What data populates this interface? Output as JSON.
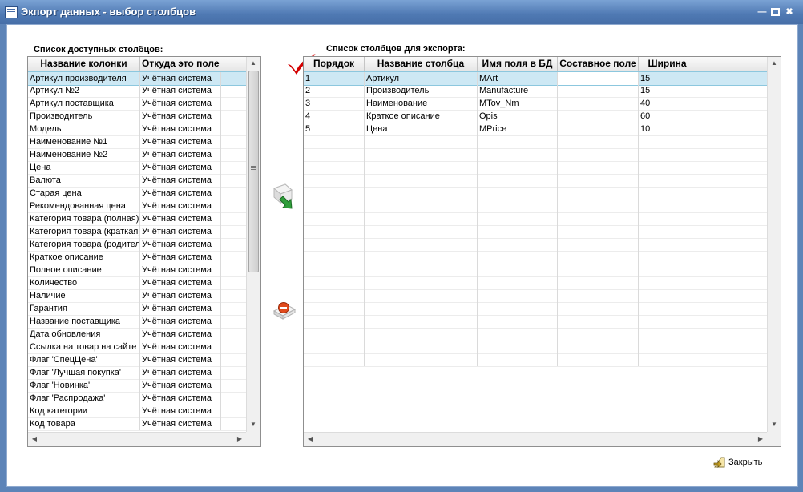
{
  "window": {
    "title": "Экпорт данных - выбор столбцов"
  },
  "left": {
    "label": "Список доступных столбцов:",
    "columns": [
      "Название колонки",
      "Откуда это поле"
    ],
    "rows": [
      [
        "Артикул производителя",
        "Учётная система"
      ],
      [
        "Артикул №2",
        "Учётная система"
      ],
      [
        "Артикул поставщика",
        "Учётная система"
      ],
      [
        "Производитель",
        "Учётная система"
      ],
      [
        "Модель",
        "Учётная система"
      ],
      [
        "Наименование №1",
        "Учётная система"
      ],
      [
        "Наименование №2",
        "Учётная система"
      ],
      [
        "Цена",
        "Учётная система"
      ],
      [
        "Валюта",
        "Учётная система"
      ],
      [
        "Старая цена",
        "Учётная система"
      ],
      [
        "Рекомендованная цена",
        "Учётная система"
      ],
      [
        "Категория товара (полная)",
        "Учётная система"
      ],
      [
        "Категория товара (краткая)",
        "Учётная система"
      ],
      [
        "Категория товара (родитель)",
        "Учётная система"
      ],
      [
        "Краткое описание",
        "Учётная система"
      ],
      [
        "Полное описание",
        "Учётная система"
      ],
      [
        "Количество",
        "Учётная система"
      ],
      [
        "Наличие",
        "Учётная система"
      ],
      [
        "Гарантия",
        "Учётная система"
      ],
      [
        "Название поставщика",
        "Учётная система"
      ],
      [
        "Дата обновления",
        "Учётная система"
      ],
      [
        "Ссылка на товар на сайте",
        "Учётная система"
      ],
      [
        "Флаг 'СпецЦена'",
        "Учётная система"
      ],
      [
        "Флаг 'Лучшая покупка'",
        "Учётная система"
      ],
      [
        "Флаг 'Новинка'",
        "Учётная система"
      ],
      [
        "Флаг 'Распродажа'",
        "Учётная система"
      ],
      [
        "Код категории",
        "Учётная система"
      ],
      [
        "Код товара",
        "Учётная система"
      ]
    ]
  },
  "right": {
    "label": "Список столбцов для экспорта:",
    "columns": [
      "Порядок",
      "Название столбца",
      "Имя поля в БД",
      "Составное поле",
      "Ширина"
    ],
    "rows": [
      [
        "1",
        "Артикул",
        "MArt",
        "",
        "15"
      ],
      [
        "2",
        "Производитель",
        "Manufacture",
        "",
        "15"
      ],
      [
        "3",
        "Наименование",
        "MTov_Nm",
        "",
        "40"
      ],
      [
        "4",
        "Краткое описание",
        "Opis",
        "",
        "60"
      ],
      [
        "5",
        "Цена",
        "MPrice",
        "",
        "10"
      ]
    ]
  },
  "buttons": {
    "close": "Закрыть"
  },
  "icons": {
    "add": "add-to-export-icon",
    "remove": "remove-from-export-icon",
    "check": "checkmark-icon",
    "close": "close-door-icon"
  },
  "colors": {
    "titlebar": "#4f79b3",
    "selection": "#cde8f4",
    "check": "#d40000"
  }
}
